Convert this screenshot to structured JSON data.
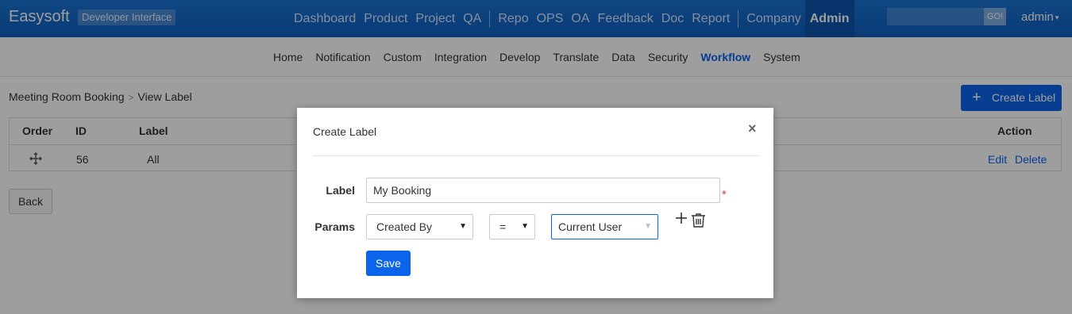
{
  "header": {
    "brand": "Easysoft",
    "badge": "Developer Interface",
    "nav_group1": [
      "Dashboard",
      "Product",
      "Project",
      "QA"
    ],
    "nav_group2": [
      "Repo",
      "OPS",
      "OA",
      "Feedback",
      "Doc",
      "Report"
    ],
    "nav_group3": [
      "Company"
    ],
    "nav_active": "Admin",
    "search_button": "GO!",
    "search_icon": "search-icon",
    "user": "admin"
  },
  "subnav": {
    "items": [
      "Home",
      "Notification",
      "Custom",
      "Integration",
      "Develop",
      "Translate",
      "Data",
      "Security",
      "Workflow",
      "System"
    ],
    "active": "Workflow"
  },
  "breadcrumb": {
    "parent": "Meeting Room Booking",
    "current": "View Label"
  },
  "create_label_button": "Create Label",
  "table": {
    "headers": {
      "order": "Order",
      "id": "ID",
      "label": "Label",
      "action": "Action"
    },
    "rows": [
      {
        "id": "56",
        "label": "All",
        "edit": "Edit",
        "delete": "Delete"
      }
    ]
  },
  "back_button": "Back",
  "modal": {
    "title": "Create Label",
    "label_field": {
      "label": "Label",
      "value": "My Booking",
      "required_mark": "*"
    },
    "params_field": {
      "label": "Params",
      "field_value": "Created By",
      "operator_value": "=",
      "target_value": "Current User"
    },
    "save_button": "Save"
  },
  "colors": {
    "topbar": "#1a73d3",
    "primary": "#0c64eb",
    "required": "#e23d3d"
  }
}
